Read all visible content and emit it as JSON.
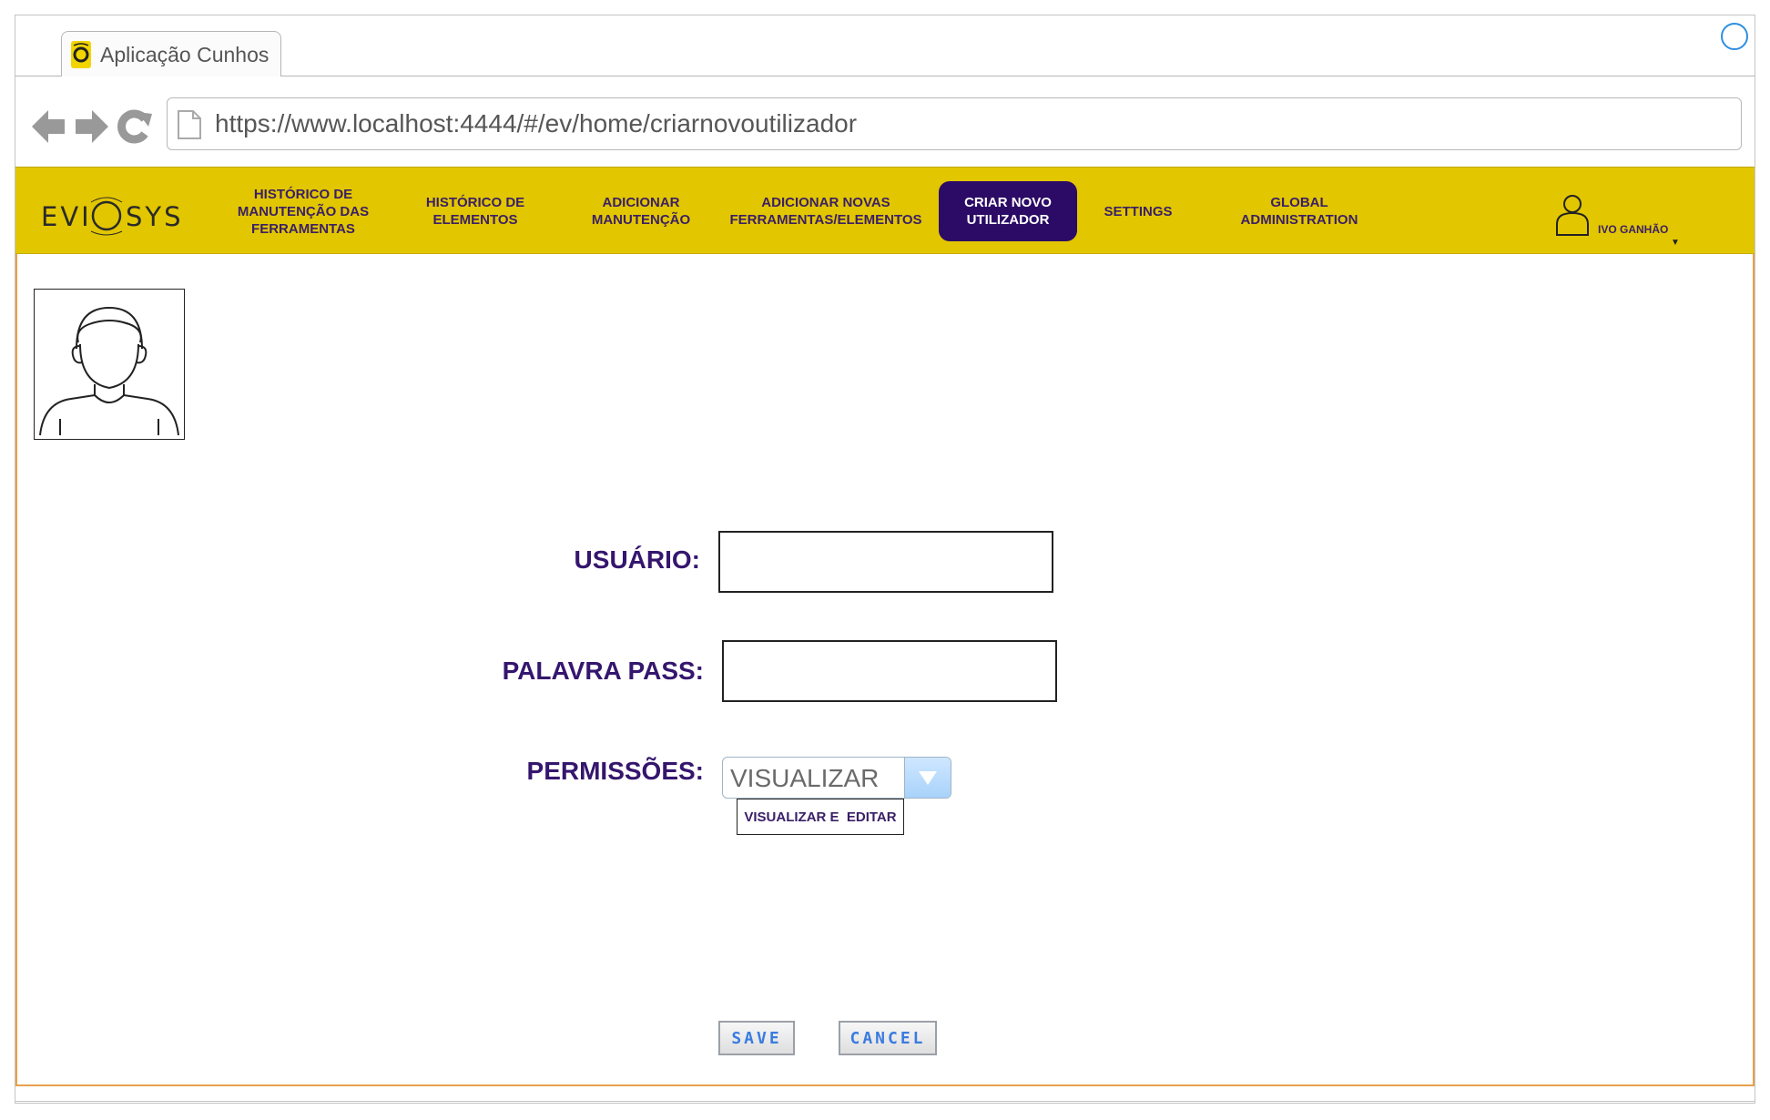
{
  "browser": {
    "tab_title": "Aplicação Cunhos",
    "url": "https://www.localhost:4444/#/ev/home/criarnovoutilizador"
  },
  "app": {
    "logo_text": "EVIOSYS",
    "brand_color": "#e2c600",
    "accent_color": "#2b0b66"
  },
  "nav": {
    "items": [
      {
        "label": "HISTÓRICO DE\nMANUTENÇÃO DAS\nFERRAMENTAS"
      },
      {
        "label": "HISTÓRICO DE\nELEMENTOS"
      },
      {
        "label": "ADICIONAR\nMANUTENÇÃO"
      },
      {
        "label": "ADICIONAR NOVAS\nFERRAMENTAS/ELEMENTOS"
      },
      {
        "label": "CRIAR NOVO\nUTILIZADOR",
        "active": true
      },
      {
        "label": "SETTINGS"
      },
      {
        "label": "GLOBAL\nADMINISTRATION"
      }
    ],
    "user_name": "IVO GANHÃO",
    "user_caret": "▼"
  },
  "form": {
    "usuario_label": "USUÁRIO:",
    "usuario_value": "",
    "password_label": "PALAVRA PASS:",
    "password_value": "",
    "permissoes_label": "PERMISSÕES:",
    "permissoes_selected": "VISUALIZAR",
    "permissoes_options": [
      "VISUALIZAR E  EDITAR"
    ]
  },
  "actions": {
    "save_label": "SAVE",
    "cancel_label": "CANCEL"
  }
}
